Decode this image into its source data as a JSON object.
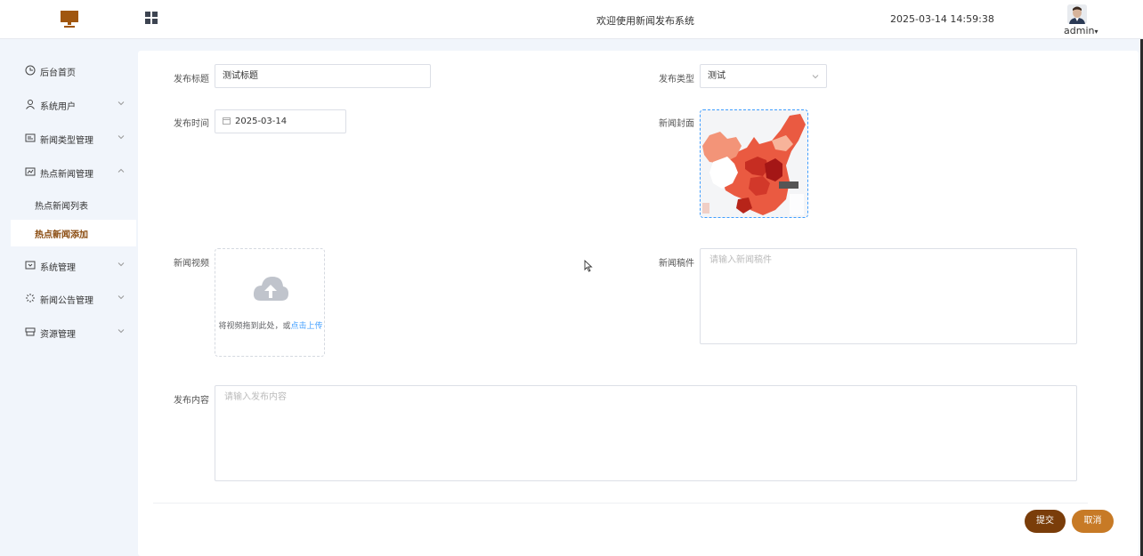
{
  "header": {
    "welcome": "欢迎使用新闻发布系统",
    "datetime": "2025-03-14 14:59:38",
    "user": "admin",
    "logo_icon": "monitor-icon",
    "toggle_icon": "grid-icon",
    "brand_color": "#8a4b0f"
  },
  "sidebar": {
    "items": [
      {
        "label": "后台首页",
        "icon": "clock-icon"
      },
      {
        "label": "系统用户",
        "icon": "user-icon",
        "chevron": "down"
      },
      {
        "label": "新闻类型管理",
        "icon": "card-icon",
        "chevron": "down"
      },
      {
        "label": "热点新闻管理",
        "icon": "chart-icon",
        "chevron": "up"
      },
      {
        "label": "系统管理",
        "icon": "folder-icon",
        "chevron": "down"
      },
      {
        "label": "新闻公告管理",
        "icon": "spinner-icon",
        "chevron": "down"
      },
      {
        "label": "资源管理",
        "icon": "box-icon",
        "chevron": "down"
      }
    ],
    "subitems": [
      {
        "label": "热点新闻列表"
      },
      {
        "label": "热点新闻添加",
        "active": true
      }
    ]
  },
  "form": {
    "title_label": "发布标题",
    "title_value": "测试标题",
    "type_label": "发布类型",
    "type_value": "测试",
    "time_label": "发布时间",
    "time_value": "2025-03-14",
    "cover_label": "新闻封面",
    "video_label": "新闻视频",
    "video_hint": "将视频拖到此处，或",
    "video_link": "点击上传",
    "manuscript_label": "新闻稿件",
    "manuscript_placeholder": "请输入新闻稿件",
    "content_label": "发布内容",
    "content_placeholder": "请输入发布内容"
  },
  "actions": {
    "submit": "提交",
    "cancel": "取消",
    "submit_color": "#7a3d0a",
    "cancel_color": "#c77a26"
  }
}
